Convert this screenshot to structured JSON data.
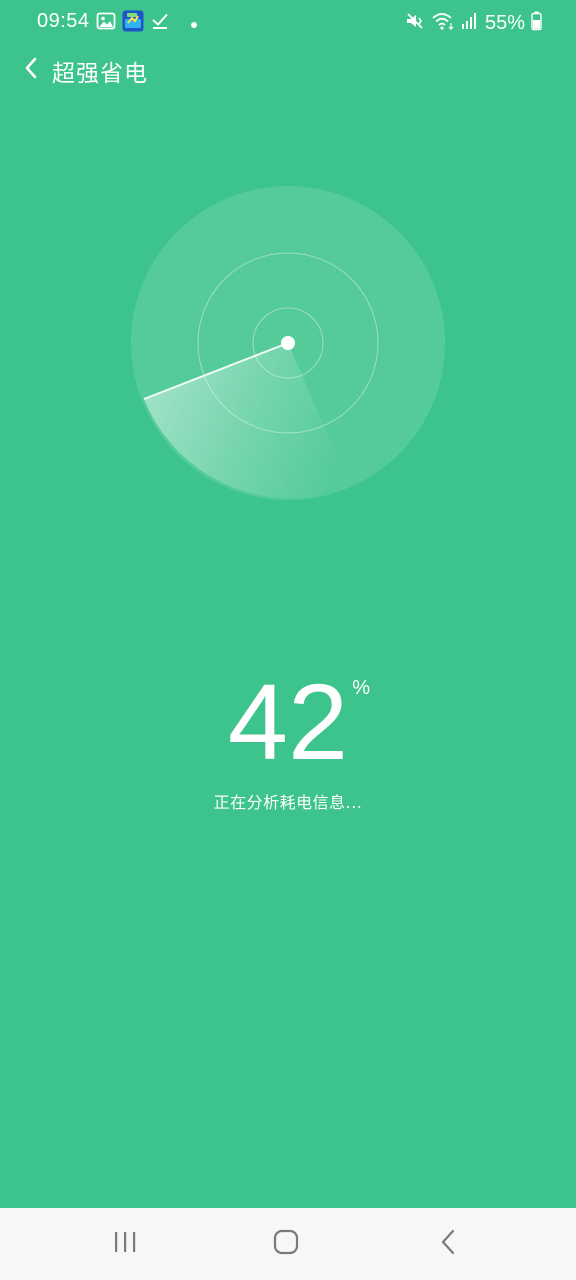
{
  "status_bar": {
    "time": "09:54",
    "battery_percent": "55%",
    "left_icons": [
      "gallery-icon",
      "app-notification-icon",
      "download-done-icon",
      "dot-icon"
    ],
    "right_icons": [
      "vibrate-mute-icon",
      "wifi-icon",
      "signal-icon",
      "battery-icon"
    ]
  },
  "app_bar": {
    "title": "超强省电",
    "back_icon": "chevron-left-icon"
  },
  "scanner": {
    "progress_value": "42",
    "progress_fraction": 0.42,
    "percent_sign": "%",
    "message": "正在分析耗电信息..."
  },
  "navigation_bar": {
    "buttons": [
      "recent-apps-icon",
      "home-icon",
      "back-icon"
    ]
  },
  "colors": {
    "background": "#3cc48c",
    "nav_bar": "#f7f7f7",
    "nav_icon": "#7a7a7a",
    "text": "#ffffff"
  }
}
